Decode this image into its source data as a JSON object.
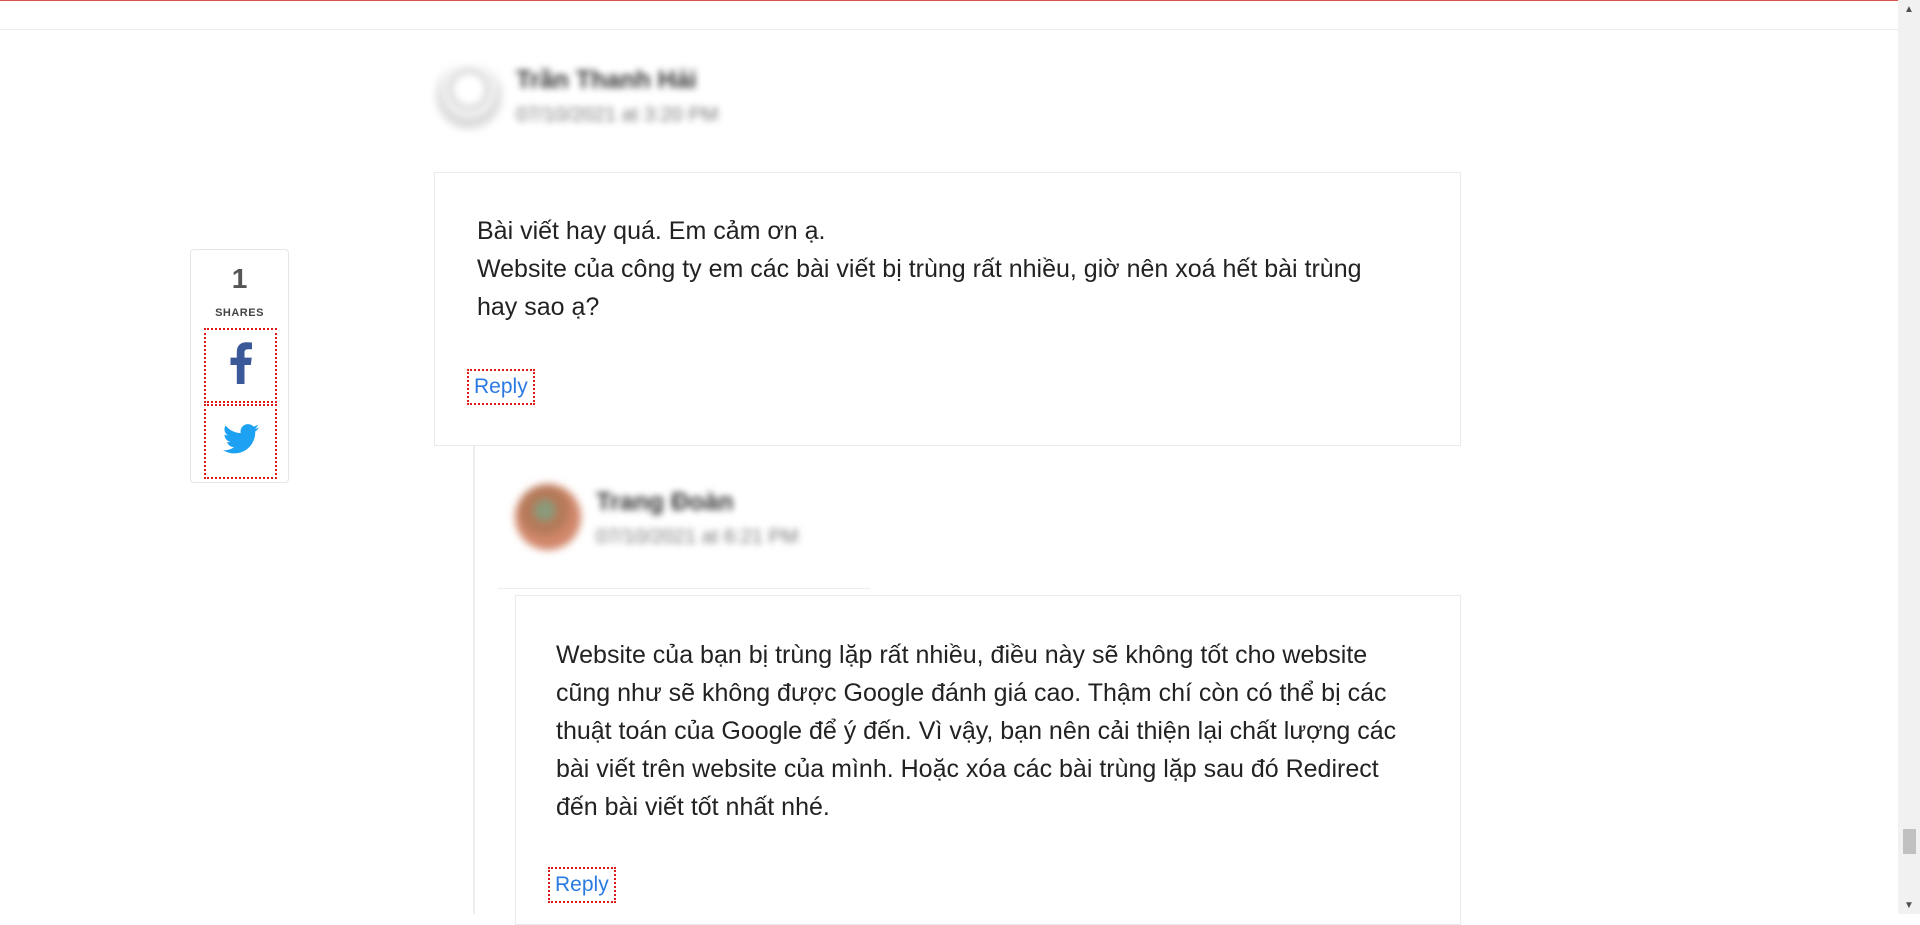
{
  "share_widget": {
    "count": "1",
    "label": "SHARES",
    "buttons": [
      {
        "icon": "facebook-icon",
        "color": "#3b5998"
      },
      {
        "icon": "twitter-icon",
        "color": "#1da1f2"
      }
    ]
  },
  "comments": [
    {
      "author": "Trần Thanh Hải",
      "date": "07/10/2021 at 3:20 PM",
      "text": "Bài viết hay quá. Em cảm ơn ạ.\nWebsite của công ty em các bài viết bị trùng rất nhiều, giờ nên xoá hết bài trùng\nhay sao ạ?",
      "reply_label": "Reply"
    },
    {
      "author": "Trang Đoàn",
      "date": "07/10/2021 at 6:21 PM",
      "text": "Website của bạn bị trùng lặp rất nhiều, điều này sẽ không tốt cho website\ncũng như sẽ không được Google đánh giá cao. Thậm chí còn có thể bị các\nthuật toán của Google để ý đến. Vì vậy, bạn nên cải thiện lại chất lượng các\nbài viết trên website của mình. Hoặc xóa các bài trùng lặp sau đó Redirect\nđến bài viết tốt nhất nhé.",
      "reply_label": "Reply"
    }
  ],
  "colors": {
    "link": "#2a7ae2",
    "focus_outline": "#e01818",
    "top_border": "#d9534f"
  }
}
